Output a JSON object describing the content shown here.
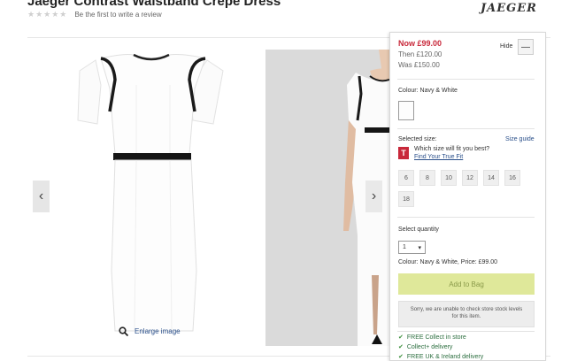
{
  "product": {
    "title": "Jaeger Contrast Waistband Crepe Dress",
    "stars": "★★★★★",
    "review_link": "Be the first to write a review"
  },
  "brand": {
    "logo_text": "JAEGER"
  },
  "gallery": {
    "prev_icon": "‹",
    "next_icon": "›",
    "enlarge_label": "Enlarge image"
  },
  "pricing": {
    "now": "Now £99.00",
    "then": "Then £120.00",
    "was": "Was £150.00",
    "hide_label": "Hide",
    "collapse_icon": "—"
  },
  "colour": {
    "label": "Colour: Navy & White",
    "swatch_color": "#fdfdfd"
  },
  "size": {
    "label": "Selected size:",
    "guide_link": "Size guide",
    "truefit_logo": "T",
    "truefit_question": "Which size will fit you best?",
    "truefit_link": "Find Your True Fit",
    "options": [
      "6",
      "8",
      "10",
      "12",
      "14",
      "16",
      "18"
    ]
  },
  "quantity": {
    "label": "Select quantity",
    "value": "1",
    "arrow": "▾"
  },
  "summary": {
    "text": "Colour: Navy & White, Price: £99.00"
  },
  "cart": {
    "add_label": "Add to Bag",
    "stock_message": "Sorry, we are unable to check store stock levels for this item."
  },
  "delivery": [
    {
      "tick": "✔",
      "label": "FREE Collect in store"
    },
    {
      "tick": "✔",
      "label": "Collect+ delivery"
    },
    {
      "tick": "✔",
      "label": "FREE UK & Ireland delivery"
    }
  ],
  "colors": {
    "sale_red": "#c8283a",
    "link_blue": "#2a4f8a",
    "add_button": "#dfe89a",
    "delivery_green": "#2c6e3f"
  }
}
